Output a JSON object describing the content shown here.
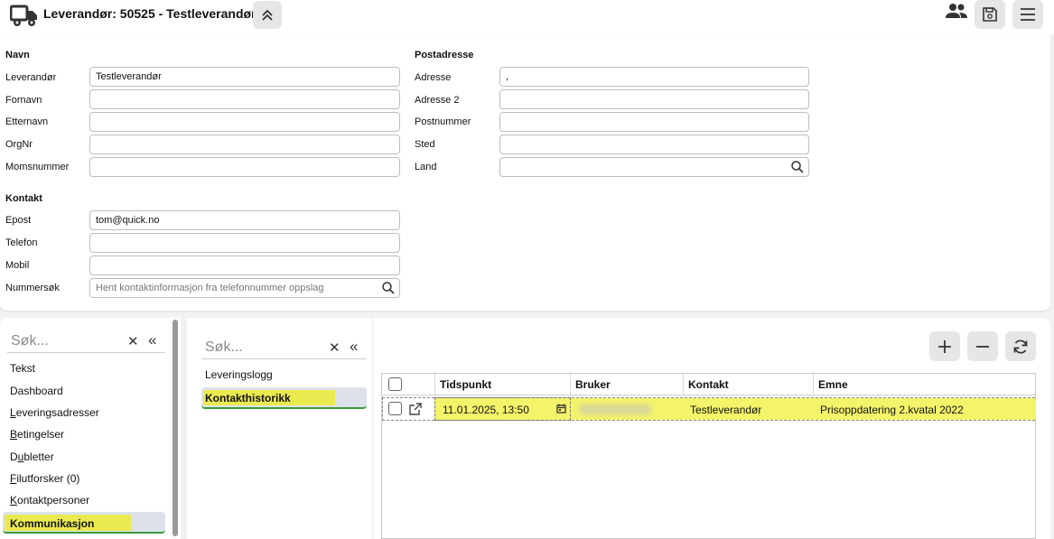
{
  "header": {
    "title": "Leverandør: 50525 - Testleverandør",
    "icons": [
      "truck-icon",
      "chevron-double-up-icon",
      "users-icon",
      "save-icon",
      "menu-icon"
    ]
  },
  "form": {
    "navn": {
      "section_title": "Navn",
      "leverandor_label": "Leverandør",
      "leverandor_value": "Testleverandør",
      "fornavn_label": "Fornavn",
      "fornavn_value": "",
      "etternavn_label": "Etternavn",
      "etternavn_value": "",
      "orgnr_label": "OrgNr",
      "orgnr_value": "",
      "momsnummer_label": "Momsnummer",
      "momsnummer_value": ""
    },
    "postadresse": {
      "section_title": "Postadresse",
      "adresse_label": "Adresse",
      "adresse_value": ",",
      "adresse2_label": "Adresse 2",
      "adresse2_value": "",
      "postnummer_label": "Postnummer",
      "postnummer_value": "",
      "sted_label": "Sted",
      "sted_value": "",
      "land_label": "Land",
      "land_value": ""
    },
    "kontakt": {
      "section_title": "Kontakt",
      "epost_label": "Epost",
      "epost_value": "tom@quick.no",
      "telefon_label": "Telefon",
      "telefon_value": "",
      "mobil_label": "Mobil",
      "mobil_value": "",
      "nummersok_label": "Nummersøk",
      "nummersok_placeholder": "Hent kontaktinformasjon fra telefonnummer oppslag"
    }
  },
  "left_nav": {
    "search_placeholder": "Søk...",
    "items": [
      {
        "label": "Tekst"
      },
      {
        "label": "Dashboard"
      },
      {
        "label_first": "L",
        "label_rest": "everingsadresser"
      },
      {
        "label_first": "B",
        "label_rest": "etingelser"
      },
      {
        "label_pre": "D",
        "label_u": "u",
        "label_rest": "bletter"
      },
      {
        "label_first": "F",
        "label_rest": "ilutforsker (0)"
      },
      {
        "label_first": "K",
        "label_rest": "ontaktpersoner"
      },
      {
        "label": "Kommunikasjon",
        "active": true
      }
    ]
  },
  "mid_nav": {
    "search_placeholder": "Søk...",
    "items": [
      {
        "label": "Leveringslogg"
      },
      {
        "label": "Kontakthistorikk",
        "active": true
      }
    ]
  },
  "grid": {
    "columns": [
      "Tidspunkt",
      "Bruker",
      "Kontakt",
      "Emne"
    ],
    "rows": [
      {
        "tidspunkt": "11.01.2025, 13:50",
        "bruker": "",
        "kontakt": "Testleverandør",
        "emne": "Prisoppdatering 2.kvatal 2022"
      }
    ]
  },
  "colors": {
    "highlight": "#eaea50",
    "active_bg": "#dde2ea",
    "active_border": "#3a9a3a"
  }
}
